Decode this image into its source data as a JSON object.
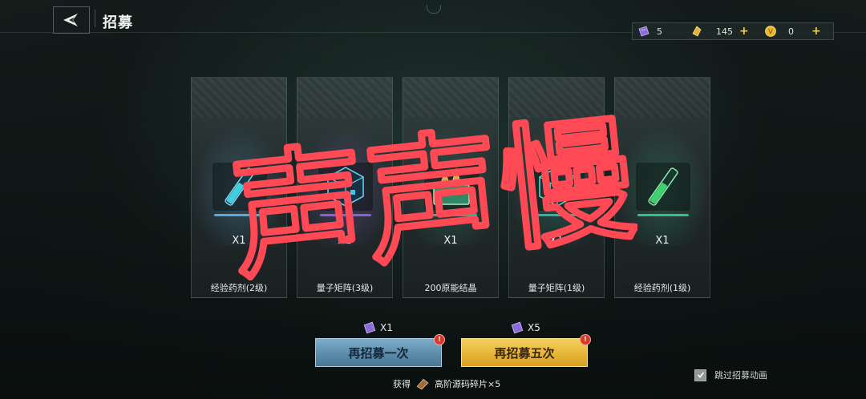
{
  "header": {
    "title": "招募"
  },
  "currencies": [
    {
      "icon": "ticket-icon",
      "value": "5",
      "has_plus": false
    },
    {
      "icon": "crystal-icon",
      "value": "145",
      "has_plus": true
    },
    {
      "icon": "coin-icon",
      "value": "0",
      "has_plus": true
    }
  ],
  "cards": [
    {
      "qty": "X1",
      "name": "经验药剂(2级)",
      "icon": "potion-icon",
      "accent": "#5aa9e0"
    },
    {
      "qty": "X1",
      "name": "量子矩阵(3级)",
      "icon": "cube-icon",
      "accent": "#8b5fd6"
    },
    {
      "qty": "X1",
      "name": "200原能结晶",
      "icon": "crystal-chest-icon",
      "accent": "#3fb08a"
    },
    {
      "qty": "X1",
      "name": "量子矩阵(1级)",
      "icon": "cube-icon",
      "accent": "#2fb39a"
    },
    {
      "qty": "X1",
      "name": "经验药剂(1级)",
      "icon": "potion-icon",
      "accent": "#33c08a"
    }
  ],
  "actions": {
    "once": {
      "label": "再招募一次",
      "cost": "X1",
      "badge": "!"
    },
    "five": {
      "label": "再招募五次",
      "cost": "X5",
      "badge": "!"
    }
  },
  "reward": {
    "prefix": "获得",
    "item": "高阶源码碎片×5"
  },
  "skip_label": "跳过招募动画",
  "overlay_text": "声声慢",
  "colors": {
    "overlay": "#ff4a55",
    "once_button": "#6e9fbd",
    "five_button": "#e9b83a"
  }
}
